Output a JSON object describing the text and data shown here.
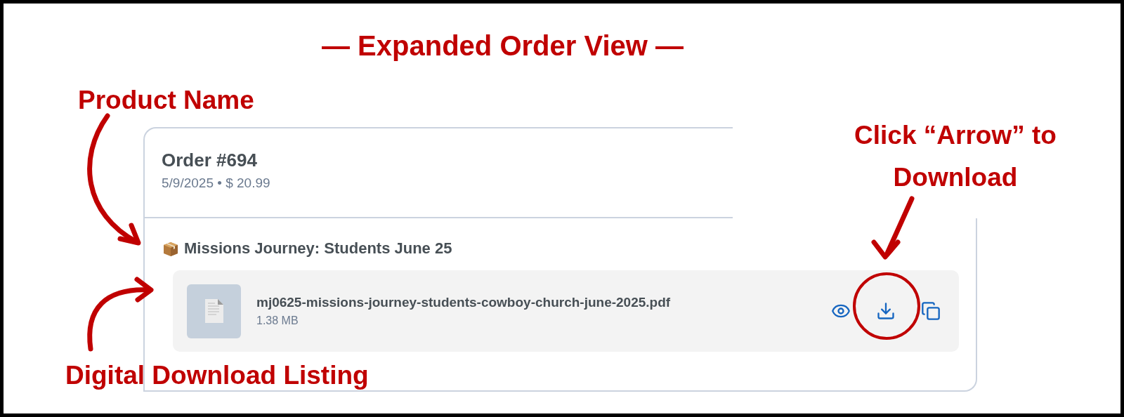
{
  "title": "— Expanded Order View —",
  "callouts": [
    {
      "text": "Product Name"
    },
    {
      "text": "Click “Arrow” to Download"
    },
    {
      "text": "Digital Download Listing"
    }
  ],
  "order": {
    "title": "Order #694",
    "meta": "5/9/2025 • $ 20.99",
    "product_name": "Missions Journey: Students June 25",
    "file": {
      "name": "mj0625-missions-journey-students-cowboy-church-june-2025.pdf",
      "size": "1.38 MB"
    }
  }
}
